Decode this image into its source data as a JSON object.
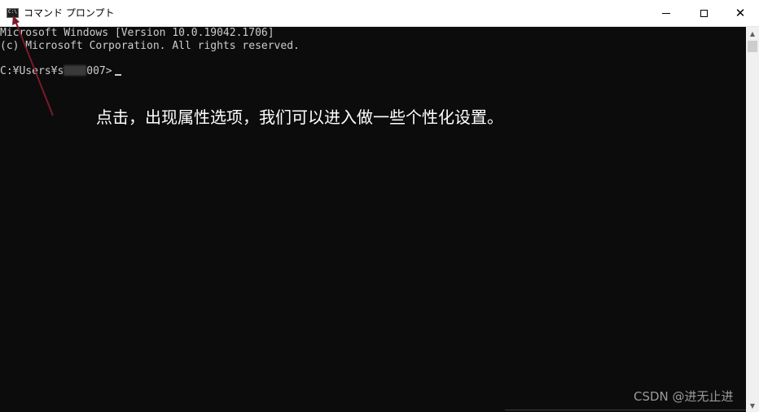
{
  "window": {
    "title": "コマンド プロンプト",
    "icon": "console-app-icon",
    "icon_glyph": "C:\\",
    "controls": {
      "minimize_icon": "minimize-icon",
      "maximize_icon": "maximize-icon",
      "close_icon": "close-icon",
      "close_glyph": "✕"
    }
  },
  "console": {
    "lines": [
      "Microsoft Windows [Version 10.0.19042.1706]",
      "(c) Microsoft Corporation. All rights reserved."
    ],
    "prompt_prefix": "C:¥Users¥s",
    "prompt_suffix": "007>",
    "text_color": "#cccccc",
    "background": "#0c0c0c"
  },
  "annotation": {
    "text": "点击，出现属性选项，我们可以进入做一些个性化设置。",
    "arrow_color": "#7a1a2a"
  },
  "scrollbar": {
    "up_glyph": "▲",
    "down_glyph": "▼"
  },
  "watermark": {
    "text": "CSDN @进无止进"
  }
}
